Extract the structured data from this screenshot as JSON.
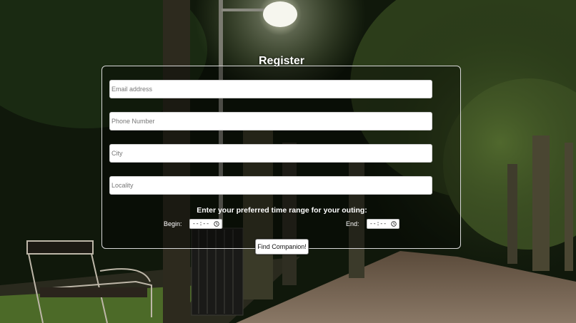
{
  "form": {
    "title": "Register",
    "email_placeholder": "Email address",
    "phone_placeholder": "Phone Number",
    "city_placeholder": "City",
    "locality_placeholder": "Locality",
    "time_prompt": "Enter your preferred time range for your outing:",
    "begin_label": "Begin:",
    "begin_value": "--:--",
    "end_label": "End:",
    "end_value": "--:--",
    "submit_label": "Find Companion!"
  },
  "icons": {
    "time_picker": "clock-icon"
  },
  "colors": {
    "card_border": "#d8d8d8",
    "text": "#ffffff",
    "field_background": "#ffffff"
  }
}
